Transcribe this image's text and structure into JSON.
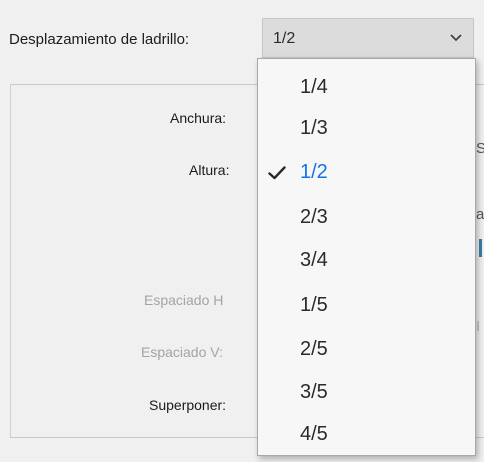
{
  "brick_offset": {
    "label": "Desplazamiento de ladrillo:",
    "selected_value": "1/2",
    "arrow_icon": "chevron-down-icon"
  },
  "form": {
    "width_label": "Anchura:",
    "height_label": "Altura:",
    "h_spacing_label": "Espaciado H",
    "v_spacing_label": "Espaciado V:",
    "overlap_label": "Superponer:"
  },
  "edge": {
    "glyph_1": "S",
    "glyph_2": "a",
    "glyph_3": "I"
  },
  "dropdown": {
    "options": [
      {
        "label": "1/4",
        "selected": false
      },
      {
        "label": "1/3",
        "selected": false
      },
      {
        "label": "1/2",
        "selected": true
      },
      {
        "label": "2/3",
        "selected": false
      },
      {
        "label": "3/4",
        "selected": false
      },
      {
        "label": "1/5",
        "selected": false
      },
      {
        "label": "2/5",
        "selected": false
      },
      {
        "label": "3/5",
        "selected": false
      },
      {
        "label": "4/5",
        "selected": false
      }
    ],
    "check_icon": "checkmark-icon",
    "selected_color": "#1473e6"
  },
  "colors": {
    "background": "#f0f0f0",
    "select_background": "#dcdcdc",
    "disabled_text": "#a4a4a4"
  }
}
